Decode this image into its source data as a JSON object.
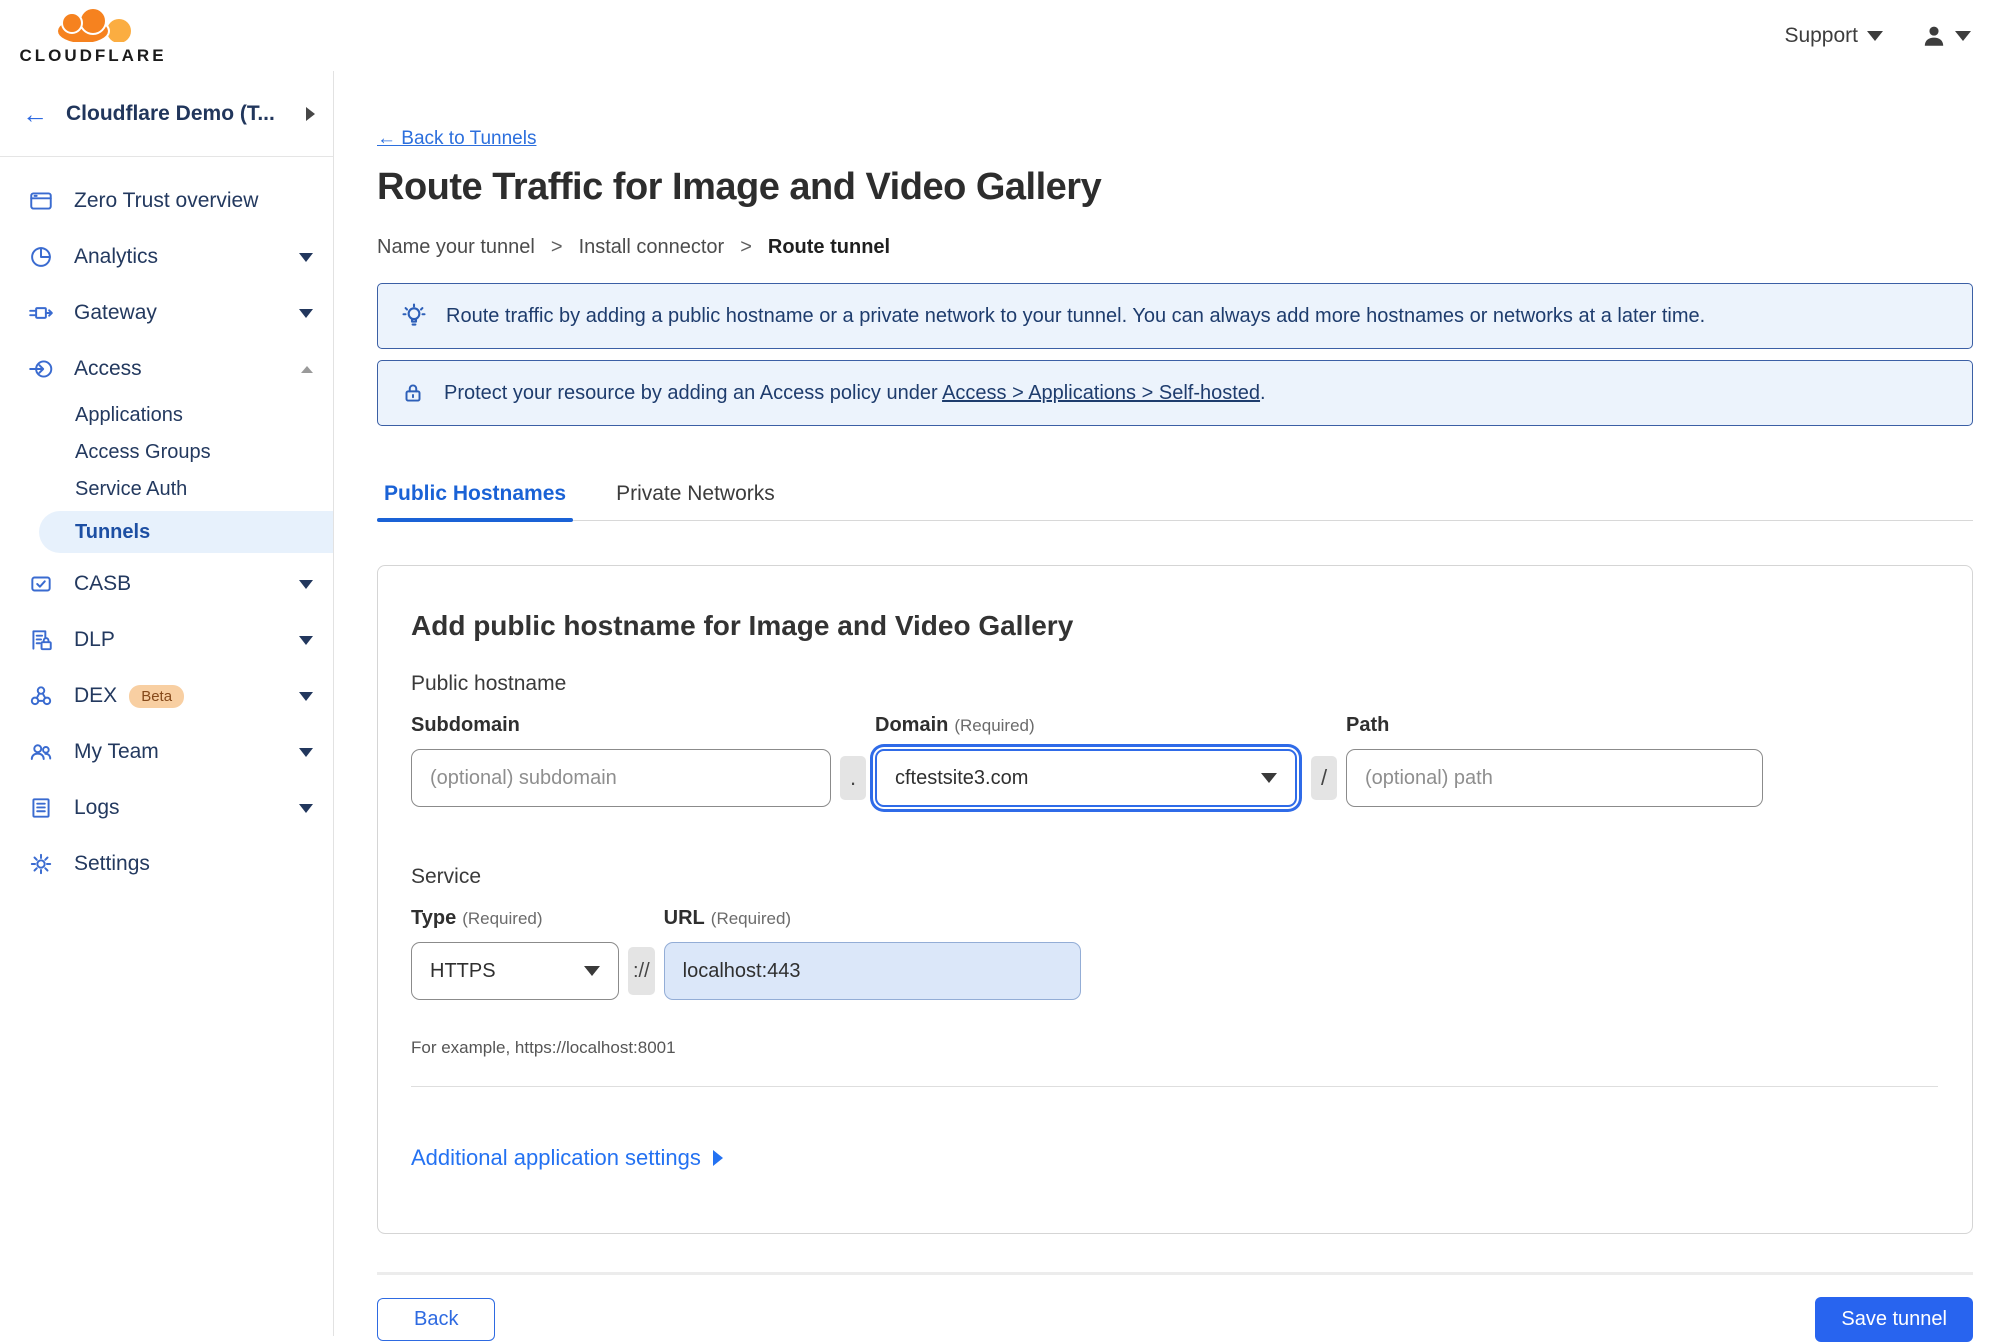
{
  "brand": {
    "wordmark": "CLOUDFLARE"
  },
  "header": {
    "support_label": "Support"
  },
  "sidebar": {
    "account_name": "Cloudflare Demo (T...",
    "items": [
      {
        "label": "Zero Trust overview"
      },
      {
        "label": "Analytics"
      },
      {
        "label": "Gateway"
      },
      {
        "label": "Access",
        "children": [
          {
            "label": "Applications"
          },
          {
            "label": "Access Groups"
          },
          {
            "label": "Service Auth"
          },
          {
            "label": "Tunnels"
          }
        ]
      },
      {
        "label": "CASB"
      },
      {
        "label": "DLP"
      },
      {
        "label": "DEX",
        "badge": "Beta"
      },
      {
        "label": "My Team"
      },
      {
        "label": "Logs"
      },
      {
        "label": "Settings"
      }
    ]
  },
  "main": {
    "back_link": "← Back to Tunnels",
    "title": "Route Traffic for Image and Video Gallery",
    "steps": [
      "Name your tunnel",
      "Install connector",
      "Route tunnel"
    ],
    "step_separator": ">",
    "banners": [
      {
        "text": "Route traffic by adding a public hostname or a private network to your tunnel. You can always add more hostnames or networks at a later time."
      },
      {
        "text_prefix": "Protect your resource by adding an Access policy under ",
        "link": "Access > Applications > Self-hosted",
        "text_suffix": "."
      }
    ],
    "tabs": [
      {
        "label": "Public Hostnames"
      },
      {
        "label": "Private Networks"
      }
    ],
    "form": {
      "heading": "Add public hostname for Image and Video Gallery",
      "public_hostname_label": "Public hostname",
      "required_label": "(Required)",
      "subdomain": {
        "label": "Subdomain",
        "placeholder": "(optional) subdomain"
      },
      "domain": {
        "label": "Domain",
        "value": "cftestsite3.com"
      },
      "path": {
        "label": "Path",
        "placeholder": "(optional) path"
      },
      "separators": {
        "dot": ".",
        "slash": "/",
        "scheme": "://"
      },
      "service_label": "Service",
      "type": {
        "label": "Type",
        "value": "HTTPS"
      },
      "url": {
        "label": "URL",
        "value": "localhost:443"
      },
      "example_text": "For example, https://localhost:8001",
      "additional_settings_label": "Additional application settings"
    },
    "footer": {
      "back_label": "Back",
      "save_label": "Save tunnel"
    }
  },
  "colors": {
    "accent_blue": "#2e6ae1",
    "active_tab_blue": "#1a62d6",
    "banner_bg": "#ecf3fc",
    "banner_border": "#3b5fa5",
    "banner_text": "#1e3c6d",
    "save_button_blue": "#2864ef",
    "logo_orange": "#f6821f",
    "logo_light_orange": "#fbad41",
    "beta_badge_bg": "#f8cfa2"
  }
}
